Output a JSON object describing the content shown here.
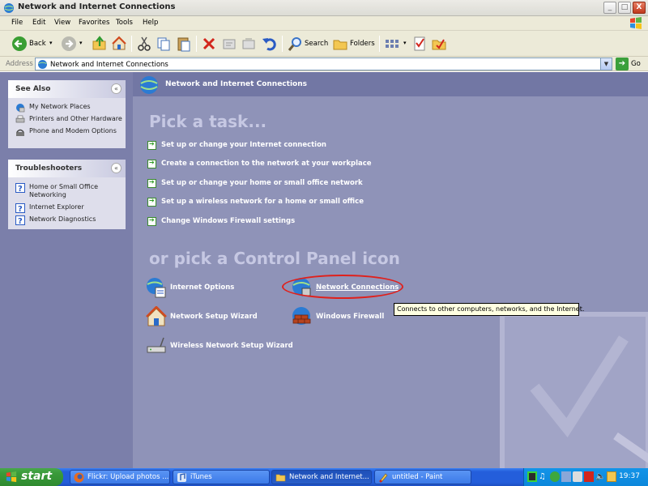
{
  "window": {
    "title": "Network and Internet Connections",
    "minimize_label": "_",
    "maximize_label": "□",
    "close_label": "X"
  },
  "menu": {
    "items": [
      "File",
      "Edit",
      "View",
      "Favorites",
      "Tools",
      "Help"
    ]
  },
  "toolbar": {
    "back_label": "Back",
    "search_label": "Search",
    "folders_label": "Folders"
  },
  "address": {
    "label": "Address",
    "value": "Network and Internet Connections",
    "go_label": "Go"
  },
  "see_also": {
    "title": "See Also",
    "collapse_label": "«",
    "items": [
      {
        "label": "My Network Places",
        "icon": "network-places-icon"
      },
      {
        "label": "Printers and Other Hardware",
        "icon": "printer-icon"
      },
      {
        "label": "Phone and Modem Options",
        "icon": "phone-icon"
      }
    ]
  },
  "troubleshooters": {
    "title": "Troubleshooters",
    "collapse_label": "«",
    "items": [
      {
        "label": "Home or Small Office Networking",
        "icon": "help-icon"
      },
      {
        "label": "Internet Explorer",
        "icon": "help-icon"
      },
      {
        "label": "Network Diagnostics",
        "icon": "help-icon"
      }
    ]
  },
  "main": {
    "header": "Network and Internet Connections",
    "pick_task": "Pick a task...",
    "tasks": [
      "Set up or change your Internet connection",
      "Create a connection to the network at your workplace",
      "Set up or change your home or small office network",
      "Set up a wireless network for a home or small office",
      "Change Windows Firewall settings"
    ],
    "pick_icon": "or pick a Control Panel icon",
    "icons": {
      "internet_options": "Internet Options",
      "network_connections": "Network Connections",
      "network_setup_wizard": "Network Setup Wizard",
      "windows_firewall": "Windows Firewall",
      "wireless_wizard": "Wireless Network Setup Wizard"
    },
    "tooltip": "Connects to other computers, networks, and the Internet."
  },
  "taskbar": {
    "start_label": "start",
    "buttons": [
      {
        "label": "Flickr: Upload photos ...",
        "icon": "firefox-icon"
      },
      {
        "label": "iTunes",
        "icon": "itunes-icon"
      },
      {
        "label": "Network and Internet...",
        "icon": "folder-icon",
        "active": true
      },
      {
        "label": "untitled - Paint",
        "icon": "paint-icon"
      }
    ],
    "clock": "19:37"
  },
  "colors": {
    "content_bg": "#8f93b8",
    "sidebar_bg": "#7b7faa",
    "taskbar_blue": "#245edb",
    "start_green": "#3a9a3a",
    "annotation_red": "#e0201b"
  }
}
